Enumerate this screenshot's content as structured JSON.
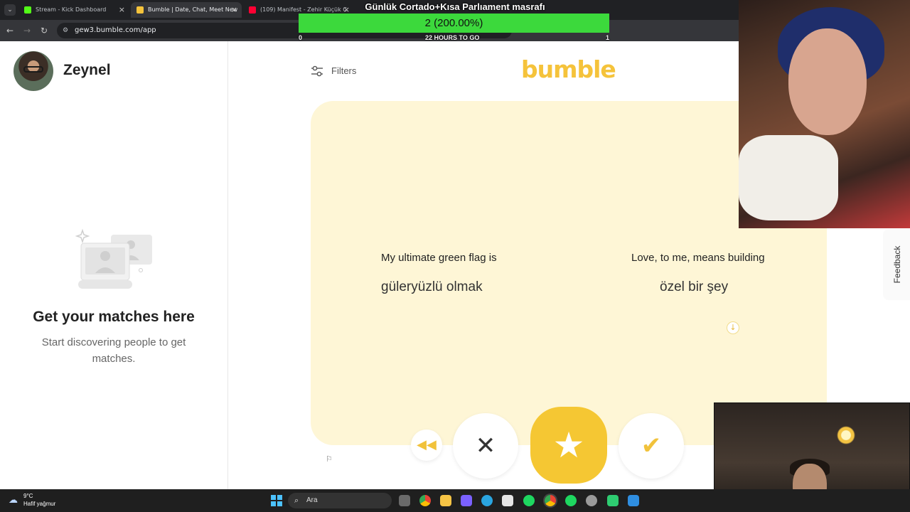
{
  "browser": {
    "tabs": [
      {
        "label": "Stream - Kick Dashboard",
        "icon": "kick-icon",
        "active": false
      },
      {
        "label": "Bumble | Date, Chat, Meet New",
        "icon": "bumble-icon",
        "active": true
      },
      {
        "label": "(109) Manifest - Zehir Küçük C",
        "icon": "youtube-icon",
        "active": false
      }
    ],
    "url": "gew3.bumble.com/app"
  },
  "overlay": {
    "title": "Günlük Cortado+Kısa Parlıament masrafı",
    "goal_text": "2 (200.00%)",
    "goal_fraction": 1.0,
    "caption_left": "0",
    "caption_center": "22 HOURS TO GO",
    "caption_right": "1"
  },
  "sidebar": {
    "username": "Zeynel",
    "empty_title": "Get your matches here",
    "empty_desc": "Start discovering people to get matches."
  },
  "main": {
    "filters_label": "Filters",
    "logo_text": "bumble",
    "prompts": [
      {
        "question": "My ultimate green flag is",
        "answer": "güleryüzlü olmak"
      },
      {
        "question": "Love, to me, means building",
        "answer": "özel bir şey"
      }
    ],
    "feedback_label": "Feedback"
  },
  "taskbar": {
    "weather_temp": "9°C",
    "weather_desc": "Hafif yağmur",
    "search_placeholder": "Ara"
  },
  "colors": {
    "brand": "#f5c33b",
    "card_bg": "#fef6d6",
    "goal_green": "#3cd93c"
  }
}
